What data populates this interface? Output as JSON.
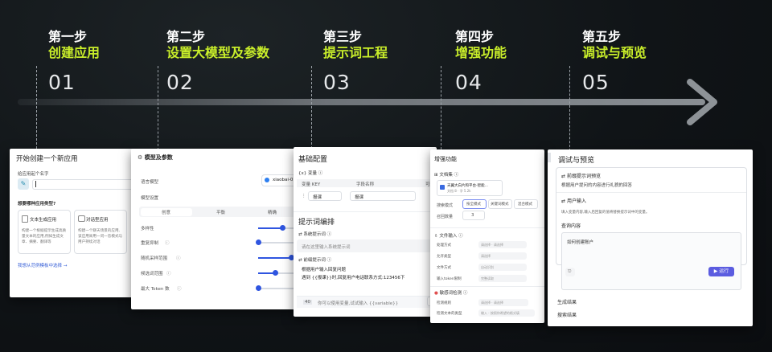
{
  "steps": [
    {
      "title": "第一步",
      "subtitle": "创建应用",
      "number": "01"
    },
    {
      "title": "第二步",
      "subtitle": "设置大模型及参数",
      "number": "02"
    },
    {
      "title": "第三步",
      "subtitle": "提示词工程",
      "number": "03"
    },
    {
      "title": "第四步",
      "subtitle": "增强功能",
      "number": "04"
    },
    {
      "title": "第五步",
      "subtitle": "调试与预览",
      "number": "05"
    }
  ],
  "card1": {
    "title": "开始创建一个新应用",
    "name_label": "给应用起个名字",
    "type_question": "想要哪种应用类型?",
    "type_text": "文本生成应用",
    "type_chat": "对话型应用",
    "desc_text": "构建一个根据提示生成高质量文本的应用,例如生成文章、摘要、翻译等",
    "desc_chat": "构建一个聊天场景的应用,该应用采用一问一答模式与用户持续对话",
    "link": "我想从范例模板中选择 →"
  },
  "card2": {
    "title": "模型及参数",
    "lang_model_label": "语言模型",
    "lang_model_value": "xiaobai-0",
    "settings_label": "模型设置",
    "tabs": [
      "创意",
      "平衡",
      "精确"
    ],
    "params": [
      "多样性",
      "重复抑制",
      "随机采样范围",
      "候选词范围",
      "最大 Token 数"
    ]
  },
  "card3": {
    "title": "基础配置",
    "var_label": "变量",
    "col_key": "变量 KEY",
    "col_name": "字段名称",
    "col_opt": "可选",
    "row_key": "报课",
    "row_name": "报课",
    "prompt_title": "提示词编排",
    "sys_label": "系统提示词",
    "sys_placeholder": "请在这里输入系统提示词",
    "user_label": "前缀提示词",
    "user_text1": "根据用户输入回复问题",
    "user_text2": "遇到 {{报课}}时,回复用户电话联系方式:123456下",
    "count": "40",
    "footer_hint": "你可以使用变量,试试输入 {{variable}}"
  },
  "card4": {
    "title": "增强功能",
    "doc_label": "文档集",
    "doc_name": "天翼大白片和平台-智能...",
    "doc_meta": "文档 8 · 字 5.2k",
    "mode_label": "搜索模式",
    "modes": [
      "按全模式",
      "关键词模式",
      "混合模式"
    ],
    "recall_label": "召回数量",
    "recall_value": "3",
    "file_label": "文件输入",
    "file_rows": [
      "处理方式",
      "允许类型",
      "文件方式",
      "输入token限制"
    ],
    "file_placeholders": [
      "请选择 · 请选择",
      "请选择",
      "自动识别",
      "完整读取"
    ],
    "filter_label": "敏感词检测",
    "filter_rows": [
      "检测规则",
      "检测文本的类型"
    ],
    "filter_placeholders": [
      "请选择 · 请选择",
      "输入 · 按照你希望的格式填"
    ]
  },
  "card5": {
    "title": "调试与预览",
    "preview_title": "前缀提示词预览",
    "preview_text": "根据用户提问的内容进行礼貌的回答",
    "user_input_title": "用户输入",
    "user_input_desc": "填入变量内容,输入后回复的值将替换提示词中的变量。",
    "query_label": "查询内容",
    "query_value": "如何创建账户",
    "run": "运行",
    "gen_result": "生成结果",
    "search_result": "搜索结果"
  }
}
